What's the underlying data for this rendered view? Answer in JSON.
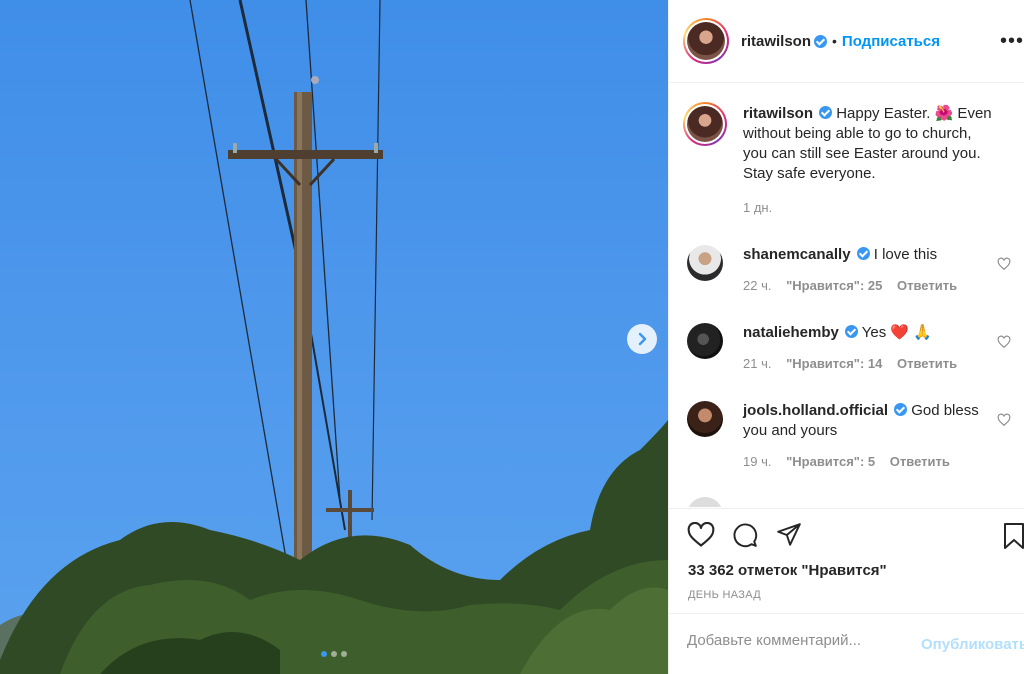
{
  "post": {
    "image_alt": "Telephone pole against a blue sky with trees",
    "carousel_dots": 3,
    "carousel_active": 0
  },
  "header": {
    "username": "ritawilson",
    "separator": "•",
    "follow_label": "Подписаться",
    "more_label": "•••"
  },
  "caption": {
    "username": "ritawilson",
    "text_before_emoji": "Happy Easter. ",
    "emoji": "🌺",
    "text_after_emoji": " Even without being able to go to church, you can still see Easter around you. Stay safe everyone.",
    "time": "1 дн."
  },
  "comments": [
    {
      "username": "shanemcanally",
      "text": "I love this",
      "time": "22 ч.",
      "likes": "\"Нравится\": 25",
      "reply": "Ответить"
    },
    {
      "username": "nataliehemby",
      "text": "Yes ❤️ 🙏",
      "time": "21 ч.",
      "likes": "\"Нравится\": 14",
      "reply": "Ответить"
    },
    {
      "username": "jools.holland.official",
      "text": "God bless you and yours",
      "time": "19 ч.",
      "likes": "\"Нравится\": 5",
      "reply": "Ответить"
    }
  ],
  "actions": {
    "likes_count": "33 362 отметок \"Нравится\"",
    "posted_ago": "ДЕНЬ НАЗАД"
  },
  "comment_box": {
    "placeholder": "Добавьте комментарий...",
    "publish_label": "Опубликовать"
  },
  "colors": {
    "accent": "#0095f6",
    "verified": "#3897f0",
    "muted": "#8e8e8e",
    "sky": "#4d97ec"
  }
}
